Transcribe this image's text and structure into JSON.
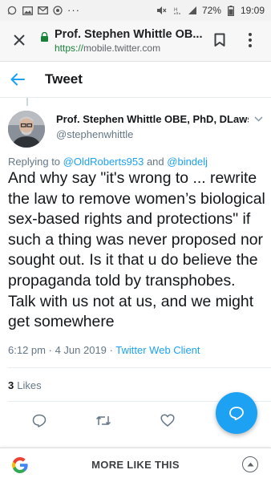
{
  "status_bar": {
    "time": "19:09",
    "battery": "72%",
    "more": "···",
    "left_icons": [
      "whatsapp-icon",
      "image-icon",
      "mail-icon",
      "chrome-icon"
    ],
    "right_icons": [
      "mute-icon",
      "data-icon",
      "signal-icon",
      "battery-icon"
    ]
  },
  "browser": {
    "page_title": "Prof. Stephen Whittle OB...",
    "url_scheme": "https://",
    "url_host": "mobile.twitter.com"
  },
  "header": {
    "title": "Tweet"
  },
  "tweet": {
    "author_name": "Prof. Stephen Whittle OBE, PhD, DLaws...",
    "handle": "@stephenwhittle",
    "replying_prefix": "Replying to",
    "reply_to_1": "@OldRoberts953",
    "reply_and": "and",
    "reply_to_2": "@bindelj",
    "text": "And why say \"it's wrong to ... rewrite the law to remove women’s biological sex-based rights and protections\" if such a thing was never proposed nor sought out. Is it that u do believe the propaganda told by transphobes. Talk with us not at us, and we might get somewhere",
    "time": "6:12 pm",
    "separator": "·",
    "date": "4 Jun 2019",
    "client": "Twitter Web Client",
    "likes_count": "3",
    "likes_label": "Likes"
  },
  "bottom_bar": {
    "label": "MORE LIKE THIS"
  },
  "colors": {
    "accent": "#1da1f2",
    "text": "#14171a",
    "muted": "#657786",
    "url_scheme": "#188038"
  }
}
